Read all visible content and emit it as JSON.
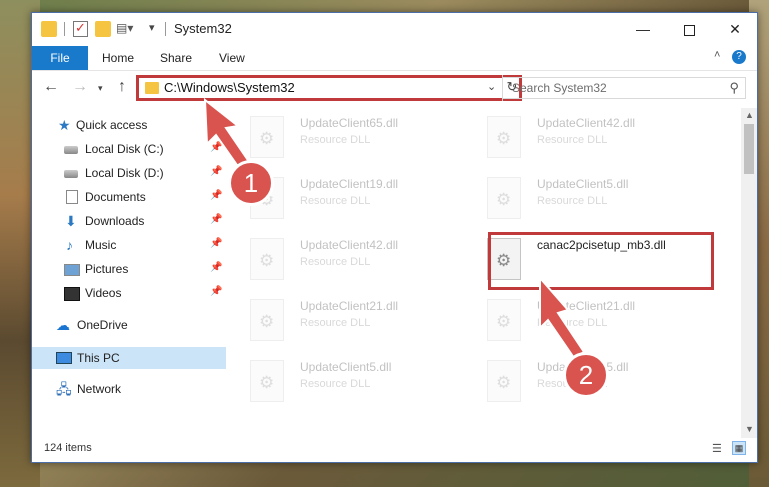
{
  "window": {
    "title": "System32",
    "props_icon": "▤▾",
    "dropdown_icon": "▾",
    "min_icon": "—",
    "close_icon": "✕"
  },
  "ribbon": {
    "tabs": [
      "File",
      "Home",
      "Share",
      "View"
    ],
    "collapse_icon": "˄",
    "help_icon": "?"
  },
  "nav": {
    "back_icon": "←",
    "forward_icon": "→",
    "recent_icon": "▾",
    "up_icon": "↑",
    "address": "C:\\Windows\\System32",
    "address_chevron": "⌄",
    "refresh_icon": "↻",
    "search_placeholder": "Search System32",
    "search_icon": "⚲"
  },
  "sidebar": {
    "quick_access": "Quick access",
    "items": [
      {
        "label": "Local Disk (C:)",
        "icon": "disk-icon"
      },
      {
        "label": "Local Disk (D:)",
        "icon": "disk-icon"
      },
      {
        "label": "Documents",
        "icon": "document-icon"
      },
      {
        "label": "Downloads",
        "icon": "download-icon"
      },
      {
        "label": "Music",
        "icon": "music-icon"
      },
      {
        "label": "Pictures",
        "icon": "pictures-icon"
      },
      {
        "label": "Videos",
        "icon": "videos-icon"
      }
    ],
    "pin_icon": "📌",
    "onedrive": "OneDrive",
    "this_pc": "This PC",
    "network": "Network"
  },
  "files": [
    {
      "name": "UpdateClient65.dll",
      "type": "Resource DLL"
    },
    {
      "name": "UpdateClient42.dll",
      "type": "Resource DLL"
    },
    {
      "name": "UpdateClient19.dll",
      "type": "Resource DLL"
    },
    {
      "name": "UpdateClient5.dll",
      "type": "Resource DLL"
    },
    {
      "name": "UpdateClient42.dll",
      "type": "Resource DLL"
    },
    {
      "name": "canac2pcisetup_mb3.dll",
      "type": ""
    },
    {
      "name": "UpdateClient21.dll",
      "type": "Resource DLL"
    },
    {
      "name": "UpdateClient21.dll",
      "type": "Resource DLL"
    },
    {
      "name": "UpdateClient5.dll",
      "type": "Resource DLL"
    },
    {
      "name": "UpdateClient5.dll",
      "type": "Resource DLL"
    }
  ],
  "status": {
    "item_count": "124 items"
  },
  "callouts": {
    "step1": "1",
    "step2": "2",
    "accent": "#d9534f"
  }
}
